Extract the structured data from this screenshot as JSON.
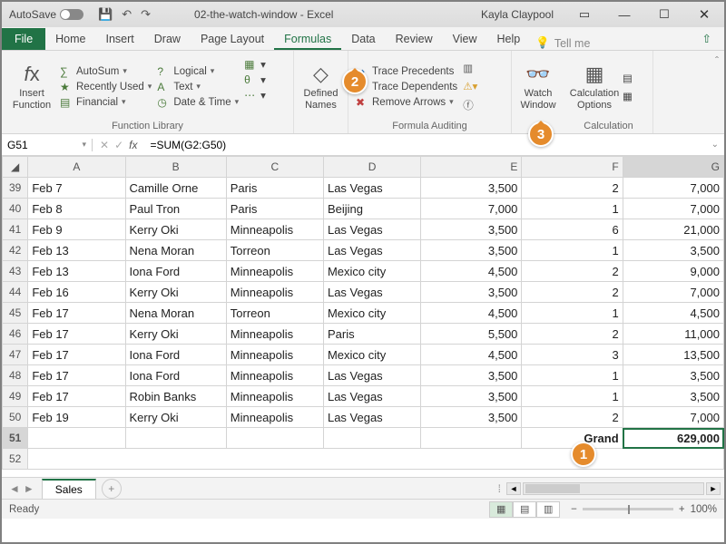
{
  "titlebar": {
    "autosave": "AutoSave",
    "document": "02-the-watch-window - Excel",
    "user": "Kayla Claypool"
  },
  "tabs": {
    "file": "File",
    "home": "Home",
    "insert": "Insert",
    "draw": "Draw",
    "pagelayout": "Page Layout",
    "formulas": "Formulas",
    "data": "Data",
    "review": "Review",
    "view": "View",
    "help": "Help",
    "tellme": "Tell me"
  },
  "ribbon": {
    "insert_function": "Insert\nFunction",
    "autosum": "AutoSum",
    "recently": "Recently Used",
    "financial": "Financial",
    "logical": "Logical",
    "text": "Text",
    "datetime": "Date & Time",
    "group1": "Function Library",
    "defined_names": "Defined\nNames",
    "trace_prec": "Trace Precedents",
    "trace_dep": "Trace Dependents",
    "remove_arrows": "Remove Arrows",
    "group2": "Formula Auditing",
    "watch_window": "Watch\nWindow",
    "calc_options": "Calculation\nOptions",
    "group3": "Calculation"
  },
  "callouts": {
    "b1": "1",
    "b2": "2",
    "b3": "3"
  },
  "fbar": {
    "cell": "G51",
    "formula": "=SUM(G2:G50)"
  },
  "cols": [
    "",
    "A",
    "B",
    "C",
    "D",
    "E",
    "F",
    "G"
  ],
  "rows": [
    {
      "n": "39",
      "a": "Feb 7",
      "b": "Camille Orne",
      "c": "Paris",
      "d": "Las Vegas",
      "e": "3,500",
      "f": "2",
      "g": "7,000"
    },
    {
      "n": "40",
      "a": "Feb 8",
      "b": "Paul Tron",
      "c": "Paris",
      "d": "Beijing",
      "e": "7,000",
      "f": "1",
      "g": "7,000"
    },
    {
      "n": "41",
      "a": "Feb 9",
      "b": "Kerry Oki",
      "c": "Minneapolis",
      "d": "Las Vegas",
      "e": "3,500",
      "f": "6",
      "g": "21,000"
    },
    {
      "n": "42",
      "a": "Feb 13",
      "b": "Nena Moran",
      "c": "Torreon",
      "d": "Las Vegas",
      "e": "3,500",
      "f": "1",
      "g": "3,500"
    },
    {
      "n": "43",
      "a": "Feb 13",
      "b": "Iona Ford",
      "c": "Minneapolis",
      "d": "Mexico city",
      "e": "4,500",
      "f": "2",
      "g": "9,000"
    },
    {
      "n": "44",
      "a": "Feb 16",
      "b": "Kerry Oki",
      "c": "Minneapolis",
      "d": "Las Vegas",
      "e": "3,500",
      "f": "2",
      "g": "7,000"
    },
    {
      "n": "45",
      "a": "Feb 17",
      "b": "Nena Moran",
      "c": "Torreon",
      "d": "Mexico city",
      "e": "4,500",
      "f": "1",
      "g": "4,500"
    },
    {
      "n": "46",
      "a": "Feb 17",
      "b": "Kerry Oki",
      "c": "Minneapolis",
      "d": "Paris",
      "e": "5,500",
      "f": "2",
      "g": "11,000"
    },
    {
      "n": "47",
      "a": "Feb 17",
      "b": "Iona Ford",
      "c": "Minneapolis",
      "d": "Mexico city",
      "e": "4,500",
      "f": "3",
      "g": "13,500"
    },
    {
      "n": "48",
      "a": "Feb 17",
      "b": "Iona Ford",
      "c": "Minneapolis",
      "d": "Las Vegas",
      "e": "3,500",
      "f": "1",
      "g": "3,500"
    },
    {
      "n": "49",
      "a": "Feb 17",
      "b": "Robin Banks",
      "c": "Minneapolis",
      "d": "Las Vegas",
      "e": "3,500",
      "f": "1",
      "g": "3,500"
    },
    {
      "n": "50",
      "a": "Feb 19",
      "b": "Kerry Oki",
      "c": "Minneapolis",
      "d": "Las Vegas",
      "e": "3,500",
      "f": "2",
      "g": "7,000"
    }
  ],
  "total_row": {
    "n": "51",
    "f": "Grand",
    "g": "629,000"
  },
  "sheet": {
    "name": "Sales"
  },
  "status": {
    "ready": "Ready",
    "zoom": "100%"
  }
}
